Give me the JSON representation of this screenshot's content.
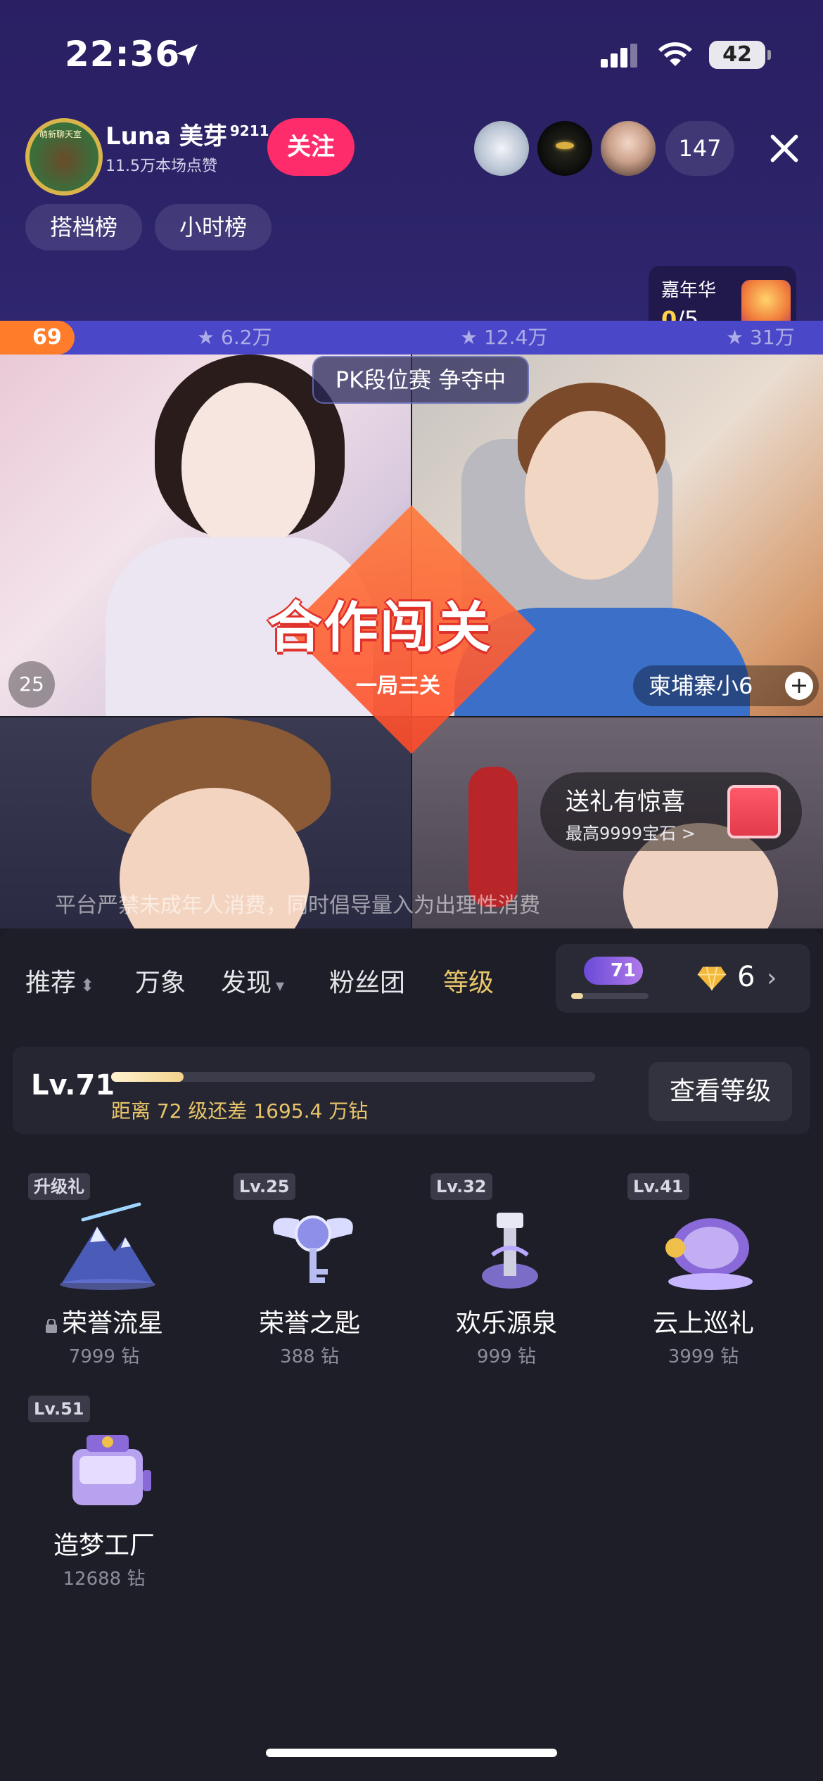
{
  "status_bar": {
    "time": "22:36",
    "battery": "42"
  },
  "host": {
    "name": "Luna 美芽",
    "name_sup": "9211",
    "likes": "11.5万本场点赞",
    "follow_label": "关注",
    "avatar_ring_text": "萌新聊天室"
  },
  "viewers": {
    "count": "147"
  },
  "rank_chips": [
    "搭档榜",
    "小时榜"
  ],
  "carnival": {
    "title": "嘉年华",
    "current": "0",
    "total": "/5"
  },
  "pk_bar": {
    "left_score": "69",
    "marks": [
      "6.2万",
      "12.4万",
      "31万"
    ]
  },
  "pk_badge": "PK段位赛 争夺中",
  "coop": {
    "title": "合作闯关",
    "subtitle": "一局三关"
  },
  "seat_number": "25",
  "name_tag": "柬埔寨小6",
  "gift_promo": {
    "title": "送礼有惊喜",
    "subtitle": "最高9999宝石 >"
  },
  "notice": "平台严禁未成年人消费，同时倡导量入为出理性消费",
  "tabs": [
    {
      "label": "推荐",
      "caret": "⬍"
    },
    {
      "label": "万象",
      "caret": ""
    },
    {
      "label": "发现",
      "caret": "▾"
    },
    {
      "label": "粉丝团",
      "caret": ""
    },
    {
      "label": "等级",
      "caret": ""
    }
  ],
  "balance": {
    "level": "71",
    "diamonds": "6",
    "level_progress": 0.15
  },
  "level_card": {
    "title": "Lv.71",
    "hint": "距离 72 级还差 1695.4 万钻",
    "button": "查看等级",
    "progress": 0.15
  },
  "gifts": [
    {
      "tag": "升级礼",
      "name": "荣誉流星",
      "price": "7999 钻",
      "locked": true
    },
    {
      "tag": "Lv.25",
      "name": "荣誉之匙",
      "price": "388 钻",
      "locked": false
    },
    {
      "tag": "Lv.32",
      "name": "欢乐源泉",
      "price": "999 钻",
      "locked": false
    },
    {
      "tag": "Lv.41",
      "name": "云上巡礼",
      "price": "3999 钻",
      "locked": false
    },
    {
      "tag": "Lv.51",
      "name": "造梦工厂",
      "price": "12688 钻",
      "locked": false
    }
  ],
  "colors": {
    "accent_pink": "#fe2c6a",
    "gold": "#e8c56a",
    "pk_orange": "#ff7d2a",
    "pk_blue": "#4b47c9"
  }
}
